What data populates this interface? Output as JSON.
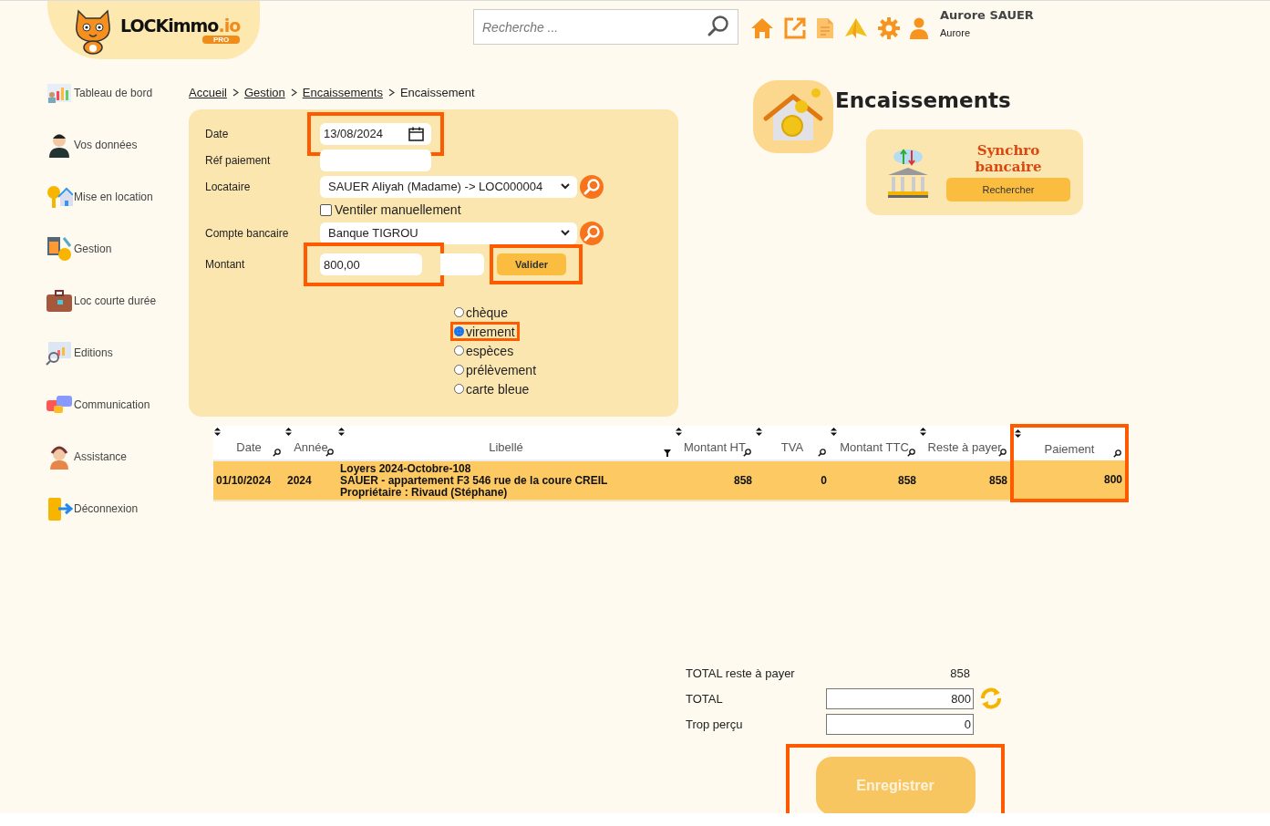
{
  "header": {
    "logo": {
      "name": "LOCKimmo",
      "suffix": ".io",
      "badge": "PRO"
    },
    "search": {
      "placeholder": "Recherche ..."
    },
    "user": {
      "name": "Aurore SAUER",
      "login": "Aurore"
    }
  },
  "sidebar": {
    "items": [
      {
        "label": "Tableau de bord",
        "kind": "chart"
      },
      {
        "label": "Vos données",
        "kind": "person"
      },
      {
        "label": "Mise en location",
        "kind": "key"
      },
      {
        "label": "Gestion",
        "kind": "calculator"
      },
      {
        "label": "Loc courte durée",
        "kind": "suitcase"
      },
      {
        "label": "Editions",
        "kind": "monitor"
      },
      {
        "label": "Communication",
        "kind": "chat"
      },
      {
        "label": "Assistance",
        "kind": "headset"
      },
      {
        "label": "Déconnexion",
        "kind": "exit"
      }
    ]
  },
  "breadcrumb": [
    {
      "label": "Accueil",
      "link": true
    },
    {
      "label": "Gestion",
      "link": true
    },
    {
      "label": "Encaissements",
      "link": true
    },
    {
      "label": "Encaissement",
      "link": false
    }
  ],
  "page_title": "Encaissements",
  "synchro": {
    "title": "Synchro bancaire",
    "button": "Rechercher"
  },
  "form": {
    "date": {
      "label": "Date",
      "value": "13/08/2024",
      "highlighted": true
    },
    "reference": {
      "label": "Réf paiement"
    },
    "tenant": {
      "label": "Locataire",
      "value": "SAUER Aliyah (Madame) -> LOC000004"
    },
    "manual_split": {
      "label": "Ventiler manuellement",
      "checked": false
    },
    "bank_account": {
      "label": "Compte bancaire",
      "value": "Banque TIGROU"
    },
    "amount": {
      "label": "Montant",
      "value": "800,00",
      "highlighted": true
    },
    "validate_button": {
      "label": "Valider",
      "highlighted": true
    },
    "payment_methods": [
      {
        "label": "chèque",
        "selected": false,
        "highlighted": false
      },
      {
        "label": "virement",
        "selected": true,
        "highlighted": true
      },
      {
        "label": "espèces",
        "selected": false,
        "highlighted": false
      },
      {
        "label": "prélèvement",
        "selected": false,
        "highlighted": false
      },
      {
        "label": "carte bleue",
        "selected": false,
        "highlighted": false
      }
    ]
  },
  "table": {
    "columns": [
      {
        "label": "Date",
        "highlighted": false
      },
      {
        "label": "Année",
        "highlighted": false
      },
      {
        "label": "Libellé",
        "highlighted": false
      },
      {
        "label": "Montant HT",
        "highlighted": false
      },
      {
        "label": "TVA",
        "highlighted": false
      },
      {
        "label": "Montant TTC",
        "highlighted": false
      },
      {
        "label": "Reste à payer",
        "highlighted": false
      },
      {
        "label": "Paiement",
        "highlighted": true
      }
    ],
    "rows": [
      {
        "date": "01/10/2024",
        "year": "2024",
        "label_lines": [
          "Loyers 2024-Octobre-108",
          "SAUER - appartement F3 546 rue de la coure CREIL",
          "Propriétaire : Rivaud (Stéphane)"
        ],
        "amount_ht": "858",
        "vat": "0",
        "amount_ttc": "858",
        "remaining": "858",
        "payment": "800"
      }
    ]
  },
  "totals": {
    "remaining": {
      "label": "TOTAL reste à payer",
      "value": "858"
    },
    "total": {
      "label": "TOTAL",
      "value": "800"
    },
    "overpaid": {
      "label": "Trop perçu",
      "value": "0"
    }
  },
  "save_button": {
    "label": "Enregistrer",
    "highlighted": true
  }
}
